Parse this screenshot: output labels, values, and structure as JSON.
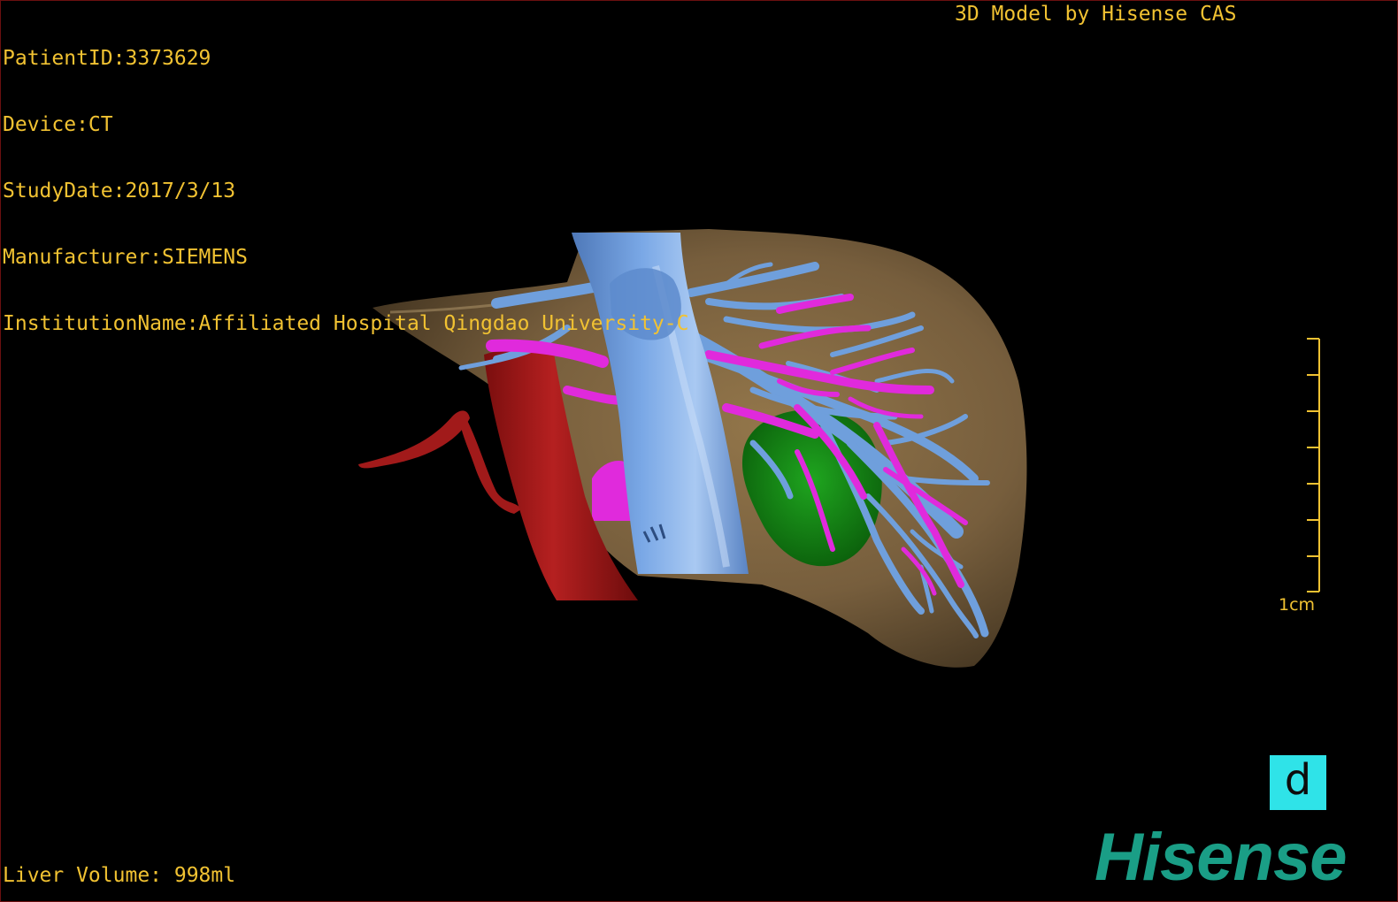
{
  "header": {
    "patient_id": "PatientID:3373629",
    "device": "Device:CT",
    "study_date": "StudyDate:2017/3/13",
    "manufacturer": "Manufacturer:SIEMENS",
    "institution": "InstitutionName:Affiliated Hospital Qingdao University-C",
    "model_credit": "3D Model by Hisense CAS"
  },
  "footer": {
    "liver_volume": "Liver Volume: 998ml"
  },
  "scale_bar": {
    "label": "1cm",
    "ticks": 8
  },
  "controls": {
    "d_button_label": "d"
  },
  "brand": {
    "logo_text": "Hisense"
  },
  "colors": {
    "overlay_text": "#f1c232",
    "liver": "#8a6e45",
    "hepatic_vein": "#6f9fdc",
    "portal_vein": "#e02adc",
    "artery": "#a01818",
    "tumor": "#148a14",
    "brand": "#1a9e86",
    "button": "#2fe3e8"
  }
}
